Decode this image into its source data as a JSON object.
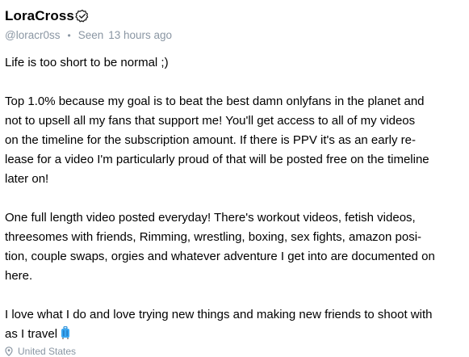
{
  "profile": {
    "display_name": "LoraCross",
    "verified_icon": "verified-badge-icon",
    "username": "@loracr0ss",
    "separator": "•",
    "seen_label": "Seen",
    "seen_time": "13 hours ago"
  },
  "bio": {
    "paragraphs": [
      [
        "Life is too short to be normal ;)"
      ],
      [
        "Top 1.0% because my goal is to beat the best damn onlyfans in the planet and",
        "not to upsell all my fans that support me! You'll get access to all of my videos",
        "on the timeline for the subscription amount. If there is PPV it's as an early re-",
        "lease for a video I'm particularly proud of that will be posted free on the timeline",
        "later on!"
      ],
      [
        "One full length video posted everyday! There's workout videos, fetish videos,",
        "threesomes with friends, Rimming, wrestling, boxing, sex fights, amazon posi-",
        "tion, couple swaps, orgies and whatever adventure I get into are documented on",
        "here."
      ],
      [
        "I love what I do and love trying new things and making new friends to shoot with",
        "as I travel"
      ]
    ],
    "trailing_emoji_icon": "luggage-icon"
  },
  "location": {
    "icon": "location-pin-icon",
    "text": "United States"
  },
  "colors": {
    "muted": "#8a96a3",
    "accent": "#00aff0",
    "text": "#000000"
  }
}
